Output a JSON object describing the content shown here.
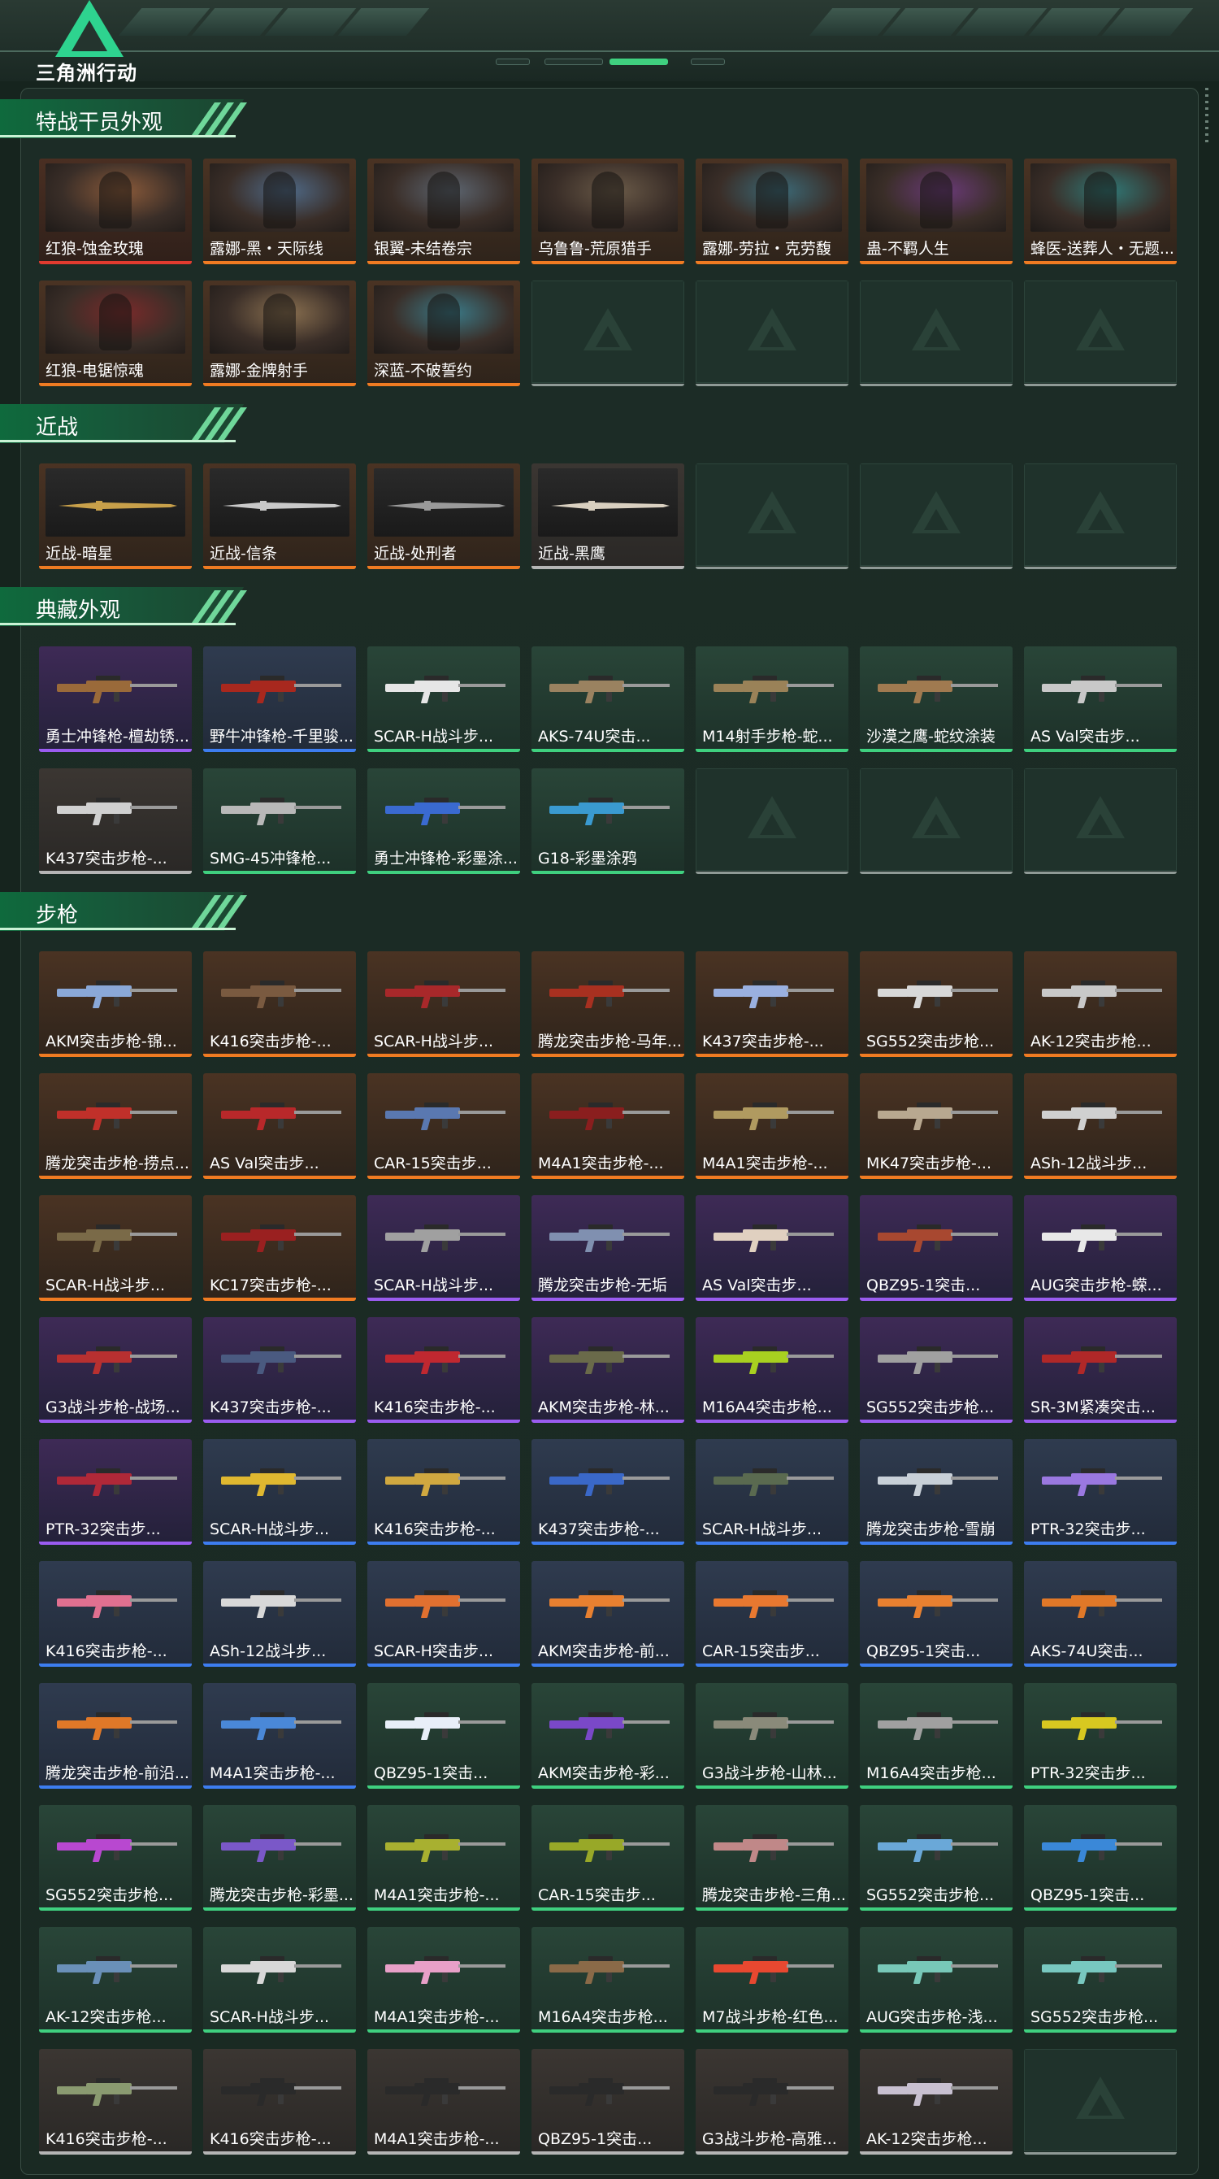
{
  "app": {
    "logo_text": "三角洲行动"
  },
  "colors": {
    "red": "#e23b2f",
    "orange": "#f07b22",
    "gray": "#b5b5b5",
    "purple": "#9a5cf0",
    "blue": "#3d7df0",
    "green": "#3fd07f",
    "accent": "#2ed38f",
    "background": "#16241e"
  },
  "sections": [
    {
      "title": "特战干员外观",
      "kind": "operator",
      "items": [
        {
          "name": "红狼-蚀金玫瑰",
          "tier": "red",
          "color": "#8a5a3a"
        },
        {
          "name": "露娜-黑・天际线",
          "tier": "orange",
          "color": "#4f6a88"
        },
        {
          "name": "银翼-未结卷宗",
          "tier": "orange",
          "color": "#5c6570"
        },
        {
          "name": "乌鲁鲁-荒原猎手",
          "tier": "orange",
          "color": "#6a5a48"
        },
        {
          "name": "露娜-劳拉・克劳馥",
          "tier": "orange",
          "color": "#3b6a78"
        },
        {
          "name": "蛊-不羁人生",
          "tier": "orange",
          "color": "#6a3a78"
        },
        {
          "name": "蜂医-送葬人・无题...",
          "tier": "orange",
          "color": "#2f7a78"
        },
        {
          "name": "红狼-电锯惊魂",
          "tier": "orange",
          "color": "#7a2a2a"
        },
        {
          "name": "露娜-金牌射手",
          "tier": "orange",
          "color": "#8a7050"
        },
        {
          "name": "深蓝-不破誓约",
          "tier": "orange",
          "color": "#3a7a88"
        },
        {
          "empty": true
        },
        {
          "empty": true
        },
        {
          "empty": true
        },
        {
          "empty": true
        }
      ]
    },
    {
      "title": "近战",
      "kind": "melee",
      "items": [
        {
          "name": "近战-暗星",
          "tier": "orange",
          "color": "#c8a04a"
        },
        {
          "name": "近战-信条",
          "tier": "orange",
          "color": "#c9c9c9"
        },
        {
          "name": "近战-处刑者",
          "tier": "orange",
          "color": "#9a9a9a"
        },
        {
          "name": "近战-黑鹰",
          "tier": "gray",
          "color": "#d9d0c0"
        },
        {
          "empty": true
        },
        {
          "empty": true
        },
        {
          "empty": true
        }
      ]
    },
    {
      "title": "典藏外观",
      "kind": "gun",
      "items": [
        {
          "name": "勇士冲锋枪-檀劫锈...",
          "tier": "purple",
          "color": "#9a6a3a"
        },
        {
          "name": "野牛冲锋枪-千里骏...",
          "tier": "blue",
          "color": "#a8281e"
        },
        {
          "name": "SCAR-H战斗步...",
          "tier": "green",
          "color": "#e6e6e6"
        },
        {
          "name": "AKS-74U突击...",
          "tier": "green",
          "color": "#9a8260"
        },
        {
          "name": "M14射手步枪-蛇...",
          "tier": "green",
          "color": "#9a8258"
        },
        {
          "name": "沙漠之鹰-蛇纹涂装",
          "tier": "green",
          "color": "#a07a50"
        },
        {
          "name": "AS Val突击步...",
          "tier": "green",
          "color": "#c8c8c8"
        },
        {
          "name": "K437突击步枪-...",
          "tier": "gray",
          "color": "#d0d0d0"
        },
        {
          "name": "SMG-45冲锋枪...",
          "tier": "green",
          "color": "#b8b8b8"
        },
        {
          "name": "勇士冲锋枪-彩墨涂...",
          "tier": "green",
          "color": "#3a6ad0"
        },
        {
          "name": "G18-彩墨涂鸦",
          "tier": "green",
          "color": "#3a9ad0"
        },
        {
          "empty": true
        },
        {
          "empty": true
        },
        {
          "empty": true
        }
      ]
    },
    {
      "title": "步枪",
      "kind": "gun",
      "items": [
        {
          "name": "AKM突击步枪-锦...",
          "tier": "orange",
          "color": "#8aa8d8"
        },
        {
          "name": "K416突击步枪-...",
          "tier": "orange",
          "color": "#7a5a40"
        },
        {
          "name": "SCAR-H战斗步...",
          "tier": "orange",
          "color": "#a8282a"
        },
        {
          "name": "腾龙突击步枪-马年...",
          "tier": "orange",
          "color": "#a83020"
        },
        {
          "name": "K437突击步枪-...",
          "tier": "orange",
          "color": "#9ab0e0"
        },
        {
          "name": "SG552突击步枪...",
          "tier": "orange",
          "color": "#d8d8d8"
        },
        {
          "name": "AK-12突击步枪...",
          "tier": "orange",
          "color": "#c8c8c8"
        },
        {
          "name": "腾龙突击步枪-捞点...",
          "tier": "orange",
          "color": "#c0302a"
        },
        {
          "name": "AS Val突击步...",
          "tier": "orange",
          "color": "#b8282a"
        },
        {
          "name": "CAR-15突击步...",
          "tier": "orange",
          "color": "#5a78b0"
        },
        {
          "name": "M4A1突击步枪-...",
          "tier": "orange",
          "color": "#8a1e1e"
        },
        {
          "name": "M4A1突击步枪-...",
          "tier": "orange",
          "color": "#b09a60"
        },
        {
          "name": "MK47突击步枪-...",
          "tier": "orange",
          "color": "#b8a890"
        },
        {
          "name": "ASh-12战斗步...",
          "tier": "orange",
          "color": "#d0d0d0"
        },
        {
          "name": "SCAR-H战斗步...",
          "tier": "orange",
          "color": "#7a6a48"
        },
        {
          "name": "KC17突击步枪-...",
          "tier": "orange",
          "color": "#9a2020"
        },
        {
          "name": "SCAR-H战斗步...",
          "tier": "purple",
          "color": "#a0a0a0"
        },
        {
          "name": "腾龙突击步枪-无垢",
          "tier": "purple",
          "color": "#8090b0"
        },
        {
          "name": "AS Val突击步...",
          "tier": "purple",
          "color": "#e0d0c0"
        },
        {
          "name": "QBZ95-1突击...",
          "tier": "purple",
          "color": "#a84830"
        },
        {
          "name": "AUG突击步枪-蝾...",
          "tier": "purple",
          "color": "#e8e8e8"
        },
        {
          "name": "G3战斗步枪-战场...",
          "tier": "purple",
          "color": "#b83030"
        },
        {
          "name": "K437突击步枪-...",
          "tier": "purple",
          "color": "#4a5a80"
        },
        {
          "name": "K416突击步枪-...",
          "tier": "purple",
          "color": "#c02830"
        },
        {
          "name": "AKM突击步枪-林...",
          "tier": "purple",
          "color": "#6a6a4a"
        },
        {
          "name": "M16A4突击步枪...",
          "tier": "purple",
          "color": "#a8d020"
        },
        {
          "name": "SG552突击步枪...",
          "tier": "purple",
          "color": "#a0a0a0"
        },
        {
          "name": "SR-3M紧凑突击...",
          "tier": "purple",
          "color": "#b02828"
        },
        {
          "name": "PTR-32突击步...",
          "tier": "purple",
          "color": "#b02838"
        },
        {
          "name": "SCAR-H战斗步...",
          "tier": "blue",
          "color": "#e0b830"
        },
        {
          "name": "K416突击步枪-...",
          "tier": "blue",
          "color": "#d0a840"
        },
        {
          "name": "K437突击步枪-...",
          "tier": "blue",
          "color": "#3a68c8"
        },
        {
          "name": "SCAR-H战斗步...",
          "tier": "blue",
          "color": "#5a6a50"
        },
        {
          "name": "腾龙突击步枪-雪崩",
          "tier": "blue",
          "color": "#c8d0d8"
        },
        {
          "name": "PTR-32突击步...",
          "tier": "blue",
          "color": "#9a78e0"
        },
        {
          "name": "K416突击步枪-...",
          "tier": "blue",
          "color": "#e07090"
        },
        {
          "name": "ASh-12战斗步...",
          "tier": "blue",
          "color": "#d8d8d8"
        },
        {
          "name": "SCAR-H突击步...",
          "tier": "blue",
          "color": "#e07030"
        },
        {
          "name": "AKM突击步枪-前...",
          "tier": "blue",
          "color": "#e88030"
        },
        {
          "name": "CAR-15突击步...",
          "tier": "blue",
          "color": "#e87830"
        },
        {
          "name": "QBZ95-1突击...",
          "tier": "blue",
          "color": "#e88030"
        },
        {
          "name": "AKS-74U突击...",
          "tier": "blue",
          "color": "#e07828"
        },
        {
          "name": "腾龙突击步枪-前沿...",
          "tier": "blue",
          "color": "#e07828"
        },
        {
          "name": "M4A1突击步枪-...",
          "tier": "blue",
          "color": "#4a88d8"
        },
        {
          "name": "QBZ95-1突击...",
          "tier": "green",
          "color": "#e8eef8"
        },
        {
          "name": "AKM突击步枪-彩...",
          "tier": "green",
          "color": "#7a48c8"
        },
        {
          "name": "G3战斗步枪-山林...",
          "tier": "green",
          "color": "#8a8a7a"
        },
        {
          "name": "M16A4突击步枪...",
          "tier": "green",
          "color": "#a0a0a0"
        },
        {
          "name": "PTR-32突击步...",
          "tier": "green",
          "color": "#d8c820"
        },
        {
          "name": "SG552突击步枪...",
          "tier": "green",
          "color": "#b848d0"
        },
        {
          "name": "腾龙突击步枪-彩墨...",
          "tier": "green",
          "color": "#7a58c8"
        },
        {
          "name": "M4A1突击步枪-...",
          "tier": "green",
          "color": "#a8b030"
        },
        {
          "name": "CAR-15突击步...",
          "tier": "green",
          "color": "#98a828"
        },
        {
          "name": "腾龙突击步枪-三角...",
          "tier": "green",
          "color": "#c08888"
        },
        {
          "name": "SG552突击步枪...",
          "tier": "green",
          "color": "#6aa8d8"
        },
        {
          "name": "QBZ95-1突击...",
          "tier": "green",
          "color": "#3a88d8"
        },
        {
          "name": "AK-12突击步枪...",
          "tier": "green",
          "color": "#6a90b8"
        },
        {
          "name": "SCAR-H战斗步...",
          "tier": "green",
          "color": "#d8d8d8"
        },
        {
          "name": "M4A1突击步枪-...",
          "tier": "green",
          "color": "#e8a0c8"
        },
        {
          "name": "M16A4突击步枪...",
          "tier": "green",
          "color": "#8a6a48"
        },
        {
          "name": "M7战斗步枪-红色...",
          "tier": "green",
          "color": "#e84830"
        },
        {
          "name": "AUG突击步枪-浅...",
          "tier": "green",
          "color": "#78c8b8"
        },
        {
          "name": "SG552突击步枪...",
          "tier": "green",
          "color": "#78c8c0"
        },
        {
          "name": "K416突击步枪-...",
          "tier": "gray",
          "color": "#8a9a70"
        },
        {
          "name": "K416突击步枪-...",
          "tier": "gray",
          "color": "#2a2a2a"
        },
        {
          "name": "M4A1突击步枪-...",
          "tier": "gray",
          "color": "#2a2a2a"
        },
        {
          "name": "QBZ95-1突击...",
          "tier": "gray",
          "color": "#2a2a2a"
        },
        {
          "name": "G3战斗步枪-高雅...",
          "tier": "gray",
          "color": "#2a2a2a"
        },
        {
          "name": "AK-12突击步枪...",
          "tier": "gray",
          "color": "#c8c0d0"
        },
        {
          "empty": true
        }
      ]
    }
  ]
}
